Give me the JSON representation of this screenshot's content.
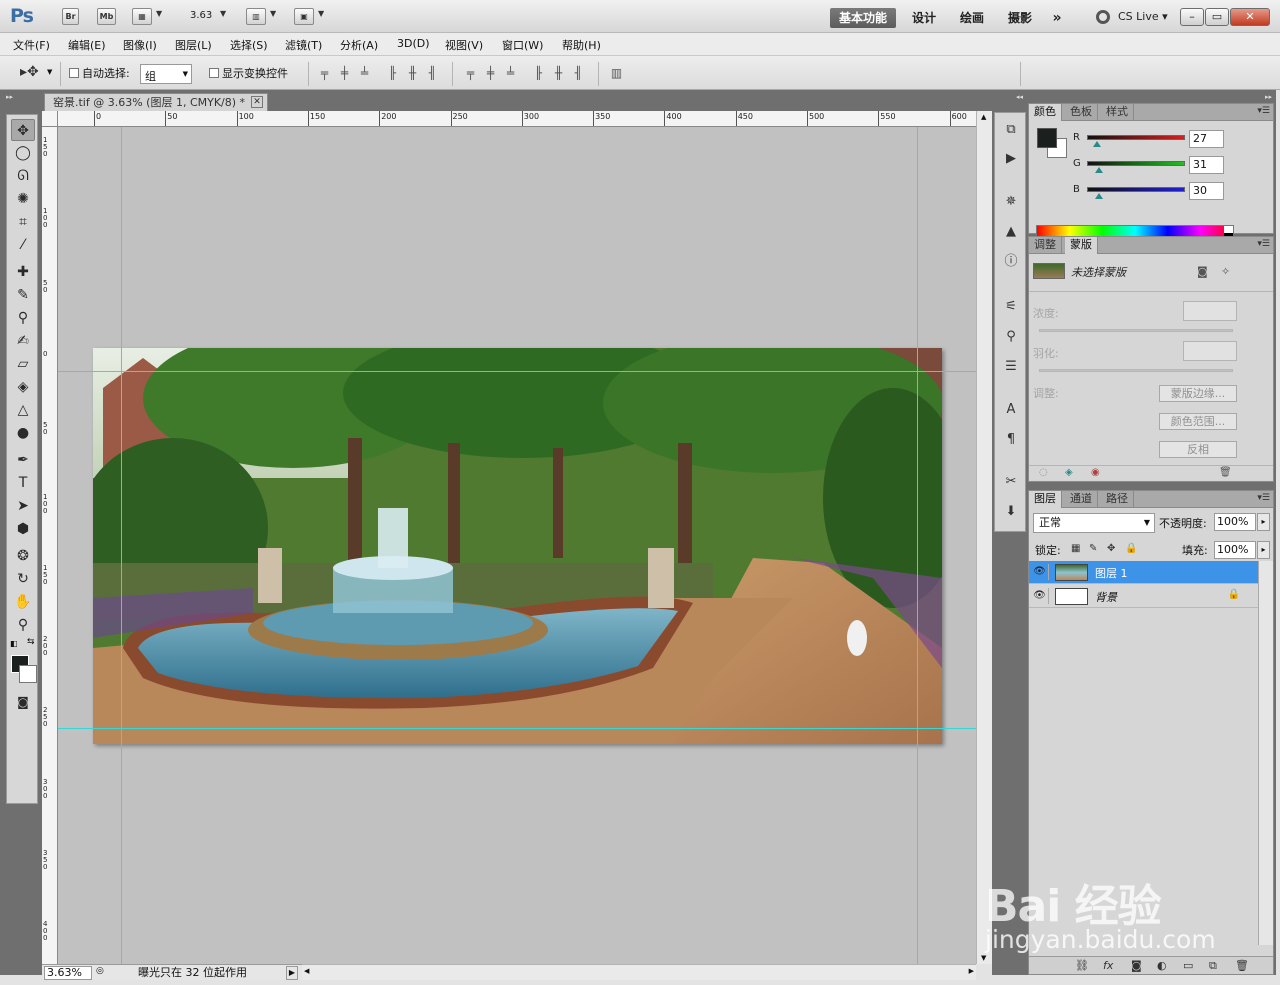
{
  "titlebar": {
    "logo": "Ps",
    "bridge": "Br",
    "minibridge": "Mb",
    "zoom": "3.63",
    "workspaces": [
      "基本功能",
      "设计",
      "绘画",
      "摄影"
    ],
    "more": "»",
    "cslive": "CS Live",
    "window_controls": {
      "minimize": "–",
      "restore": "▭",
      "close": "✕"
    }
  },
  "menu": [
    "文件(F)",
    "编辑(E)",
    "图像(I)",
    "图层(L)",
    "选择(S)",
    "滤镜(T)",
    "分析(A)",
    "3D(D)",
    "视图(V)",
    "窗口(W)",
    "帮助(H)"
  ],
  "options": {
    "auto_select_label": "自动选择:",
    "auto_select_value": "组",
    "show_transform_label": "显示变换控件"
  },
  "document": {
    "tab_title": "窑景.tif @ 3.63% (图层 1, CMYK/8) *",
    "close": "✕",
    "ruler_top": [
      "0",
      "50",
      "100",
      "150",
      "200",
      "250",
      "300",
      "350",
      "400",
      "450",
      "500",
      "550",
      "600"
    ],
    "ruler_left": [
      "150",
      "100",
      "50",
      "0",
      "50",
      "100",
      "150",
      "200",
      "250",
      "300",
      "350",
      "400"
    ]
  },
  "status": {
    "zoom": "3.63%",
    "text": "曝光只在 32 位起作用"
  },
  "color_panel": {
    "tabs": [
      "颜色",
      "色板",
      "样式"
    ],
    "channels": [
      {
        "name": "R",
        "value": "27",
        "fraction": 0.106,
        "color": "#d42020"
      },
      {
        "name": "G",
        "value": "31",
        "fraction": 0.122,
        "color": "#20c020"
      },
      {
        "name": "B",
        "value": "30",
        "fraction": 0.118,
        "color": "#2020d4"
      }
    ]
  },
  "masks_panel": {
    "tabs": [
      "调整",
      "蒙版"
    ],
    "title": "未选择蒙版",
    "density_label": "浓度:",
    "feather_label": "羽化:",
    "adjust_label": "调整:",
    "buttons": [
      "蒙版边缘...",
      "颜色范围...",
      "反相"
    ]
  },
  "layers_panel": {
    "tabs": [
      "图层",
      "通道",
      "路径"
    ],
    "blend_mode": "正常",
    "opacity_label": "不透明度:",
    "opacity": "100%",
    "lock_label": "锁定:",
    "fill_label": "填充:",
    "fill": "100%",
    "layers": [
      {
        "name": "图层 1",
        "selected": true
      },
      {
        "name": "背景",
        "selected": false,
        "locked": true
      }
    ]
  },
  "watermark": {
    "logo": "Bai 经验",
    "url": "jingyan.baidu.com"
  }
}
